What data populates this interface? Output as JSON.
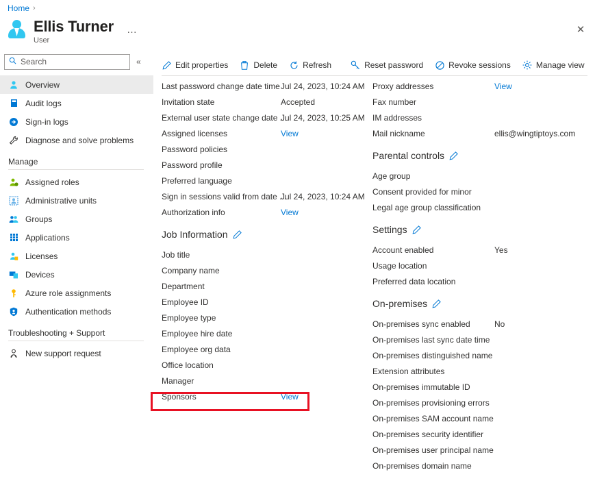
{
  "breadcrumb": {
    "home": "Home",
    "separator": "›"
  },
  "header": {
    "name": "Ellis Turner",
    "subtitle": "User",
    "ellipsis": "…",
    "close": "✕"
  },
  "sidebar": {
    "search": {
      "placeholder": "Search",
      "value": ""
    },
    "collapse": "«",
    "items": [
      {
        "label": "Overview",
        "icon": "user-icon",
        "selected": true
      },
      {
        "label": "Audit logs",
        "icon": "log-icon",
        "selected": false
      },
      {
        "label": "Sign-in logs",
        "icon": "signin-icon",
        "selected": false
      },
      {
        "label": "Diagnose and solve problems",
        "icon": "wrench-icon",
        "selected": false
      }
    ],
    "group_manage": {
      "label": "Manage",
      "items": [
        {
          "label": "Assigned roles",
          "icon": "assigned-roles-icon"
        },
        {
          "label": "Administrative units",
          "icon": "admin-units-icon"
        },
        {
          "label": "Groups",
          "icon": "groups-icon"
        },
        {
          "label": "Applications",
          "icon": "applications-icon"
        },
        {
          "label": "Licenses",
          "icon": "licenses-icon"
        },
        {
          "label": "Devices",
          "icon": "devices-icon"
        },
        {
          "label": "Azure role assignments",
          "icon": "key-icon"
        },
        {
          "label": "Authentication methods",
          "icon": "shield-icon"
        }
      ]
    },
    "group_support": {
      "label": "Troubleshooting + Support",
      "items": [
        {
          "label": "New support request",
          "icon": "support-icon"
        }
      ]
    }
  },
  "toolbar": {
    "edit_properties": "Edit properties",
    "delete": "Delete",
    "refresh": "Refresh",
    "reset_password": "Reset password",
    "revoke_sessions": "Revoke sessions",
    "manage_view": "Manage view",
    "more": "···"
  },
  "left_column": {
    "rows": [
      {
        "label": "Last password change date time",
        "value": "Jul 24, 2023, 10:24 AM",
        "link": false
      },
      {
        "label": "Invitation state",
        "value": "Accepted",
        "link": false
      },
      {
        "label": "External user state change date ...",
        "value": "Jul 24, 2023, 10:25 AM",
        "link": false
      },
      {
        "label": "Assigned licenses",
        "value": "View",
        "link": true
      },
      {
        "label": "Password policies",
        "value": "",
        "link": false
      },
      {
        "label": "Password profile",
        "value": "",
        "link": false
      },
      {
        "label": "Preferred language",
        "value": "",
        "link": false
      },
      {
        "label": "Sign in sessions valid from date ...",
        "value": "Jul 24, 2023, 10:24 AM",
        "link": false
      },
      {
        "label": "Authorization info",
        "value": "View",
        "link": true
      }
    ],
    "job_information": {
      "title": "Job Information",
      "rows": [
        {
          "label": "Job title",
          "value": "",
          "link": false
        },
        {
          "label": "Company name",
          "value": "",
          "link": false
        },
        {
          "label": "Department",
          "value": "",
          "link": false
        },
        {
          "label": "Employee ID",
          "value": "",
          "link": false
        },
        {
          "label": "Employee type",
          "value": "",
          "link": false
        },
        {
          "label": "Employee hire date",
          "value": "",
          "link": false
        },
        {
          "label": "Employee org data",
          "value": "",
          "link": false
        },
        {
          "label": "Office location",
          "value": "",
          "link": false
        },
        {
          "label": "Manager",
          "value": "",
          "link": false
        },
        {
          "label": "Sponsors",
          "value": "View",
          "link": true,
          "highlighted": true
        }
      ]
    }
  },
  "right_column": {
    "rows": [
      {
        "label": "Proxy addresses",
        "value": "View",
        "link": true
      },
      {
        "label": "Fax number",
        "value": "",
        "link": false
      },
      {
        "label": "IM addresses",
        "value": "",
        "link": false
      },
      {
        "label": "Mail nickname",
        "value": "ellis@wingtiptoys.com",
        "link": false
      }
    ],
    "parental_controls": {
      "title": "Parental controls",
      "rows": [
        {
          "label": "Age group",
          "value": "",
          "link": false
        },
        {
          "label": "Consent provided for minor",
          "value": "",
          "link": false
        },
        {
          "label": "Legal age group classification",
          "value": "",
          "link": false
        }
      ]
    },
    "settings": {
      "title": "Settings",
      "rows": [
        {
          "label": "Account enabled",
          "value": "Yes",
          "link": false
        },
        {
          "label": "Usage location",
          "value": "",
          "link": false
        },
        {
          "label": "Preferred data location",
          "value": "",
          "link": false
        }
      ]
    },
    "on_premises": {
      "title": "On-premises",
      "rows": [
        {
          "label": "On-premises sync enabled",
          "value": "No",
          "link": false
        },
        {
          "label": "On-premises last sync date time",
          "value": "",
          "link": false
        },
        {
          "label": "On-premises distinguished name",
          "value": "",
          "link": false
        },
        {
          "label": "Extension attributes",
          "value": "",
          "link": false
        },
        {
          "label": "On-premises immutable ID",
          "value": "",
          "link": false
        },
        {
          "label": "On-premises provisioning errors",
          "value": "",
          "link": false
        },
        {
          "label": "On-premises SAM account name",
          "value": "",
          "link": false
        },
        {
          "label": "On-premises security identifier",
          "value": "",
          "link": false
        },
        {
          "label": "On-premises user principal name",
          "value": "",
          "link": false
        },
        {
          "label": "On-premises domain name",
          "value": "",
          "link": false
        }
      ]
    }
  },
  "colors": {
    "link": "#0078d4",
    "accent": "#31c7f0",
    "highlight_box": "#e81123",
    "selected_nav_bg": "#ebebeb"
  }
}
